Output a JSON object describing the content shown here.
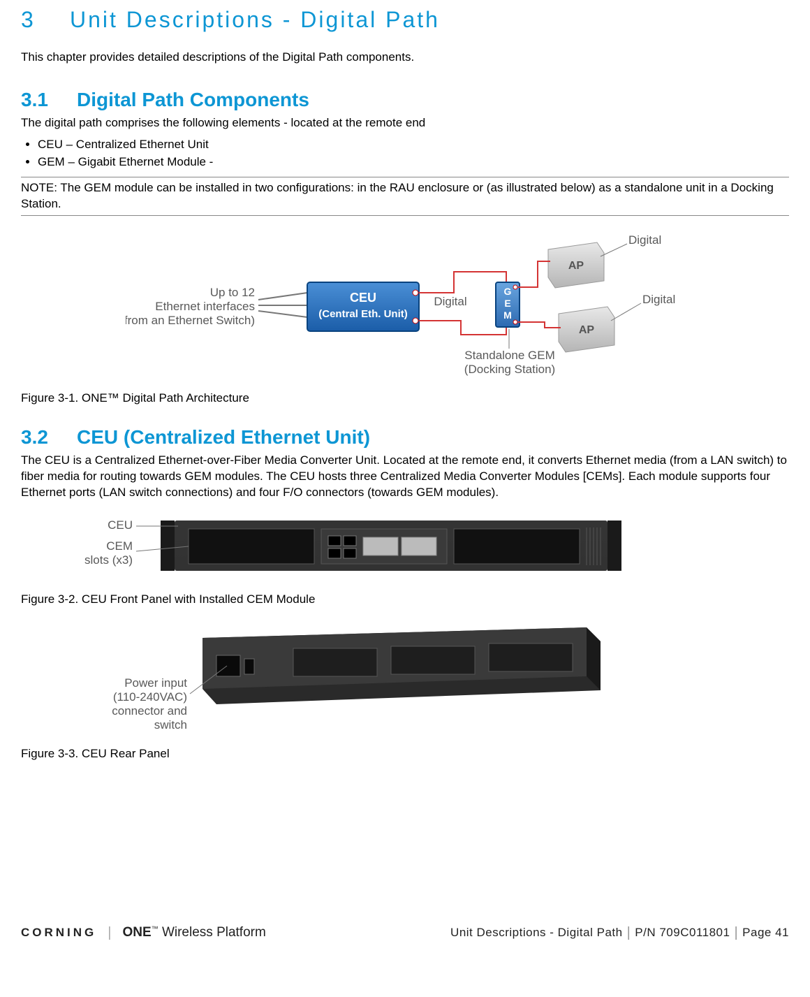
{
  "chapter": {
    "num": "3",
    "title": "Unit Descriptions - Digital Path"
  },
  "intro": "This chapter provides detailed descriptions of the Digital Path components.",
  "section31": {
    "num": "3.1",
    "title": "Digital Path Components",
    "lead": "The digital path comprises the following elements - located at the remote end",
    "bullet1": "CEU – Centralized Ethernet Unit",
    "bullet2": "GEM – Gigabit Ethernet Module -",
    "note": "NOTE: The GEM module can be installed in two configurations: in the RAU enclosure or (as illustrated below) as a standalone unit in a Docking Station."
  },
  "fig31": {
    "caption": "Figure 3-1. ONE™ Digital Path Architecture",
    "label_eth_line1": "Up to 12",
    "label_eth_line2": "Ethernet interfaces",
    "label_eth_line3": "(from an Ethernet Switch)",
    "ceu_line1": "CEU",
    "ceu_line2": "(Central Eth. Unit)",
    "digital": "Digital",
    "gem": "GEM",
    "ap": "AP",
    "standalone_line1": "Standalone GEM",
    "standalone_line2": "(Docking Station)"
  },
  "section32": {
    "num": "3.2",
    "title": "CEU (Centralized Ethernet Unit)",
    "body": "The CEU is a Centralized Ethernet-over-Fiber Media Converter Unit. Located at the remote end, it converts Ethernet media (from a LAN switch) to fiber media for routing towards GEM modules. The CEU hosts three Centralized Media Converter Modules [CEMs]. Each module supports four Ethernet ports (LAN switch connections) and four F/O connectors (towards GEM modules)."
  },
  "fig32": {
    "caption": "Figure 3-2. CEU Front Panel with Installed CEM Module",
    "label_ceu": "CEU",
    "label_cem_line1": "CEM",
    "label_cem_line2": "slots (x3)"
  },
  "fig33": {
    "caption": "Figure 3-3. CEU Rear Panel",
    "label_line1": "Power input",
    "label_line2": "(110-240VAC)",
    "label_line3": "connector and",
    "label_line4": "switch"
  },
  "footer": {
    "brand": "CORNING",
    "platform_one": "ONE",
    "platform_tm": "™",
    "platform_rest": " Wireless Platform",
    "title": "Unit Descriptions - Digital Path",
    "pn": "P/N 709C011801",
    "page": "Page 41"
  }
}
